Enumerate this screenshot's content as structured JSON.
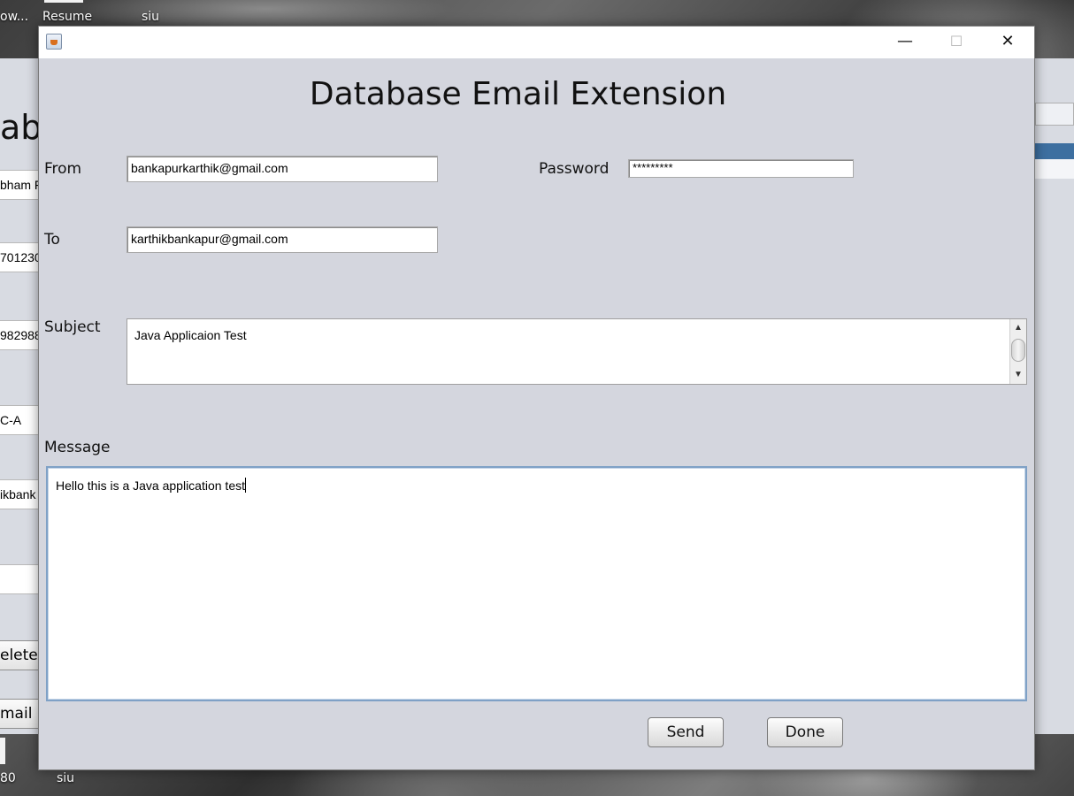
{
  "desktop": {
    "icons": [
      "ow...",
      "Resume",
      "siu",
      "80",
      "siu"
    ]
  },
  "background_app": {
    "title_fragment": "aba",
    "field_fragments": [
      "bham F",
      "701230",
      "982988",
      "C-A",
      "ikbank",
      ""
    ],
    "button_fragments": [
      "elete",
      "mail"
    ]
  },
  "window": {
    "controls": {
      "minimize": "—",
      "maximize": "☐",
      "close": "✕"
    },
    "title": "Database Email Extension"
  },
  "form": {
    "from_label": "From",
    "from_value": "bankapurkarthik@gmail.com",
    "password_label": "Password",
    "password_value": "*********",
    "to_label": "To",
    "to_value": "karthikbankapur@gmail.com",
    "subject_label": "Subject",
    "subject_value": "Java Applicaion Test",
    "message_label": "Message",
    "message_value": "Hello this is a Java application test"
  },
  "buttons": {
    "send": "Send",
    "done": "Done"
  },
  "scrollbar": {
    "up": "▲",
    "down": "▼"
  }
}
